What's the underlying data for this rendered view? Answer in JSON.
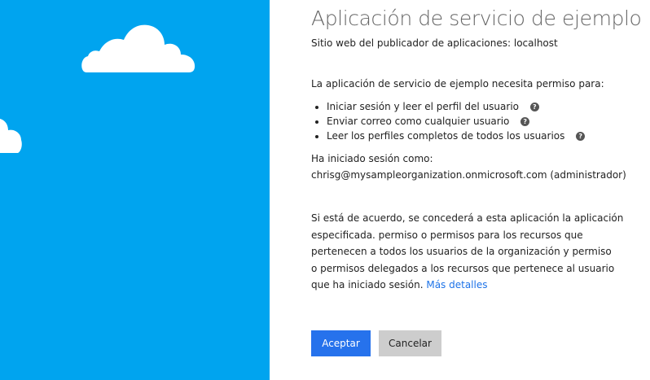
{
  "app_title": "Aplicación de servicio de ejemplo",
  "publisher": "Sitio web del publicador de aplicaciones: localhost",
  "intro": "La aplicación de servicio de ejemplo necesita permiso para:",
  "permissions": [
    {
      "label": "Iniciar sesión y leer el perfil del usuario",
      "icon": "help-icon"
    },
    {
      "label": "Enviar correo como cualquier usuario",
      "icon": "help-icon"
    },
    {
      "label": "Leer los perfiles completos de todos los usuarios",
      "icon": "help-icon"
    }
  ],
  "signed_in_label": "Ha iniciado sesión como:",
  "signed_in_user": "chrisg@mysampleorganization.onmicrosoft.com (administrador)",
  "consent_lines": [
    "Si está de acuerdo, se concederá a esta aplicación la aplicación",
    "especificada. permiso o permisos para los recursos que",
    "pertenecen a todos los usuarios de la organización y permiso",
    "o permisos delegados a los recursos que pertenece al usuario",
    "que ha iniciado sesión."
  ],
  "more_details_link": "Más detalles",
  "buttons": {
    "accept": "Aceptar",
    "cancel": "Cancelar"
  },
  "colors": {
    "sky": "#00a4ef",
    "accept_button": "#2672ec",
    "cancel_button": "#cdcdcd",
    "link": "#1e73e8"
  }
}
